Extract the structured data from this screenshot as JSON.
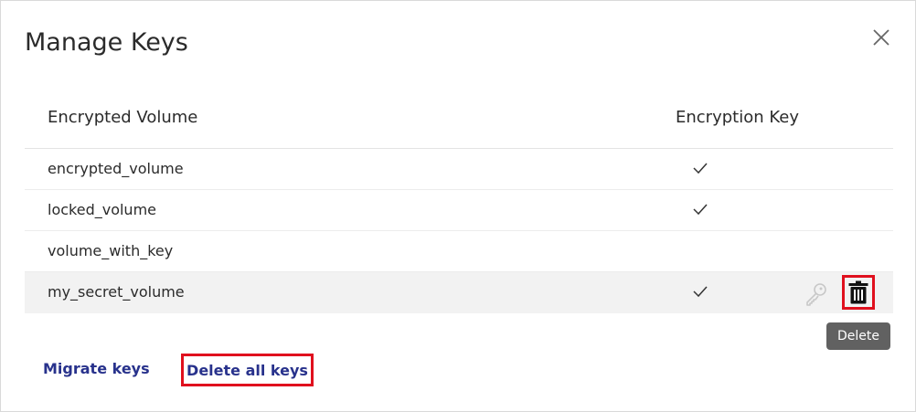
{
  "dialog": {
    "title": "Manage Keys"
  },
  "table": {
    "columns": [
      "Encrypted Volume",
      "Encryption Key"
    ],
    "rows": [
      {
        "name": "encrypted_volume",
        "has_key": true
      },
      {
        "name": "locked_volume",
        "has_key": true
      },
      {
        "name": "volume_with_key",
        "has_key": false
      },
      {
        "name": "my_secret_volume",
        "has_key": true,
        "selected": true,
        "actions": [
          "key-icon",
          "trash-icon"
        ]
      }
    ]
  },
  "tooltip": {
    "text": "Delete"
  },
  "footer": {
    "migrate_label": "Migrate keys",
    "delete_all_label": "Delete all keys"
  },
  "colors": {
    "link": "#28328c",
    "highlight_border": "#e0101e",
    "tooltip_bg": "#616161",
    "selected_row_bg": "#f2f2f2"
  }
}
